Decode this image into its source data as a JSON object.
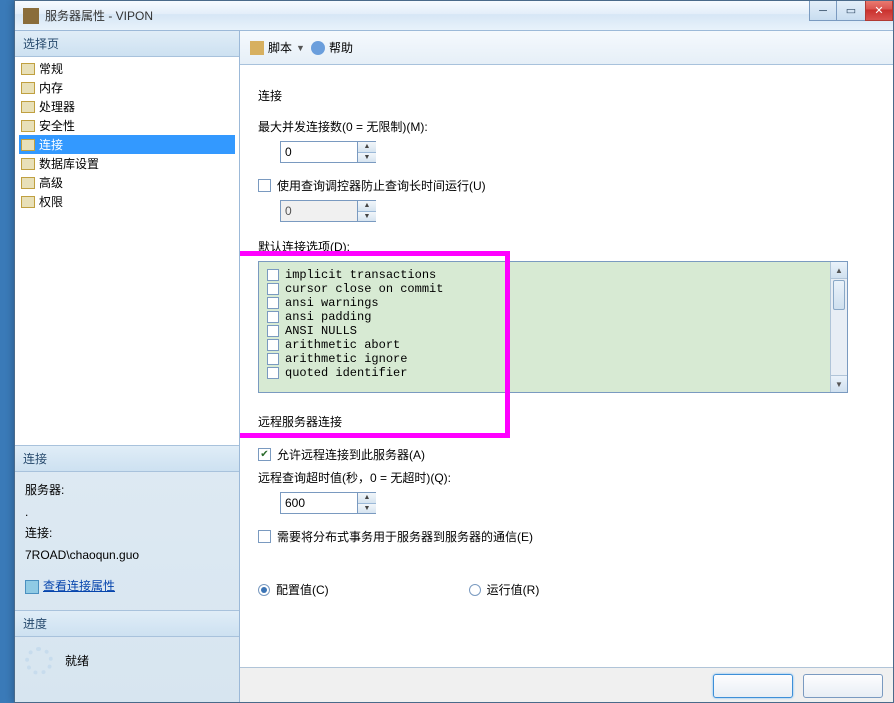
{
  "window": {
    "title": "服务器属性 - VIPON"
  },
  "sidebar": {
    "select_page": "选择页",
    "pages": [
      "常规",
      "内存",
      "处理器",
      "安全性",
      "连接",
      "数据库设置",
      "高级",
      "权限"
    ],
    "selected_index": 4,
    "conn_header": "连接",
    "server_label": "服务器:",
    "server_value": ".",
    "conn_label": "连接:",
    "conn_value": "7ROAD\\chaoqun.guo",
    "view_props": "查看连接属性",
    "progress_header": "进度",
    "progress_status": "就绪"
  },
  "toolbar": {
    "script": "脚本",
    "help": "帮助"
  },
  "panel": {
    "conn_title": "连接",
    "max_conn_label": "最大并发连接数(0 = 无限制)(M):",
    "max_conn_value": "0",
    "governor_label": "使用查询调控器防止查询长时间运行(U)",
    "governor_value": "0",
    "default_opts_label": "默认连接选项(D):",
    "opts": [
      "implicit transactions",
      "cursor close on commit",
      "ansi warnings",
      "ansi padding",
      "ANSI NULLS",
      "arithmetic abort",
      "arithmetic ignore",
      "quoted identifier"
    ],
    "remote_title": "远程服务器连接",
    "allow_remote_label": "允许远程连接到此服务器(A)",
    "remote_timeout_label": "远程查询超时值(秒，0 = 无超时)(Q):",
    "remote_timeout_value": "600",
    "dist_trans_label": "需要将分布式事务用于服务器到服务器的通信(E)",
    "radio_configured": "配置值(C)",
    "radio_running": "运行值(R)"
  }
}
